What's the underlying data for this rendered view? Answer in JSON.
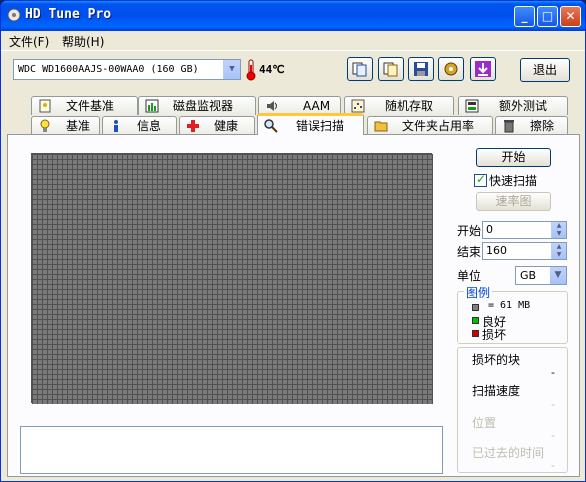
{
  "window": {
    "title": "HD Tune Pro"
  },
  "menu": {
    "file": "文件(F)",
    "help": "帮助(H)"
  },
  "toolbar": {
    "drive": "WDC WD1600AAJS-00WAA0 (160 GB)",
    "temperature": "44℃",
    "exit_label": "退出",
    "icons": [
      "copy-info-icon",
      "copy-screen-icon",
      "save-icon",
      "options-icon",
      "download-icon"
    ]
  },
  "tabs_row1": [
    "文件基准",
    "磁盘监视器",
    "AAM",
    "随机存取",
    "额外测试"
  ],
  "tabs_row2": [
    "基准",
    "信息",
    "健康",
    "错误扫描",
    "文件夹占用率",
    "擦除"
  ],
  "active_tab": "错误扫描",
  "scan": {
    "start_button": "开始",
    "quick_scan_label": "快速扫描",
    "quick_scan_checked": true,
    "speed_map_button": "速率图",
    "start_label": "开始",
    "start_value": "0",
    "end_label": "结束",
    "end_value": "160",
    "unit_label": "单位",
    "unit_value": "GB"
  },
  "legend": {
    "title": "图例",
    "block_size": "= 61 MB",
    "good": "良好",
    "damaged": "损坏",
    "colors": {
      "block": "#808080",
      "good": "#00C000",
      "damaged": "#D00000"
    }
  },
  "stats": {
    "bad_blocks_label": "损坏的块",
    "bad_blocks_value": "-",
    "scan_speed_label": "扫描速度",
    "scan_speed_value": "-",
    "position_label": "位置",
    "position_value": "-",
    "elapsed_label": "已过去的时间",
    "elapsed_value": "-"
  },
  "grid": {
    "color": "#7A7A7A",
    "line": "#505050"
  }
}
